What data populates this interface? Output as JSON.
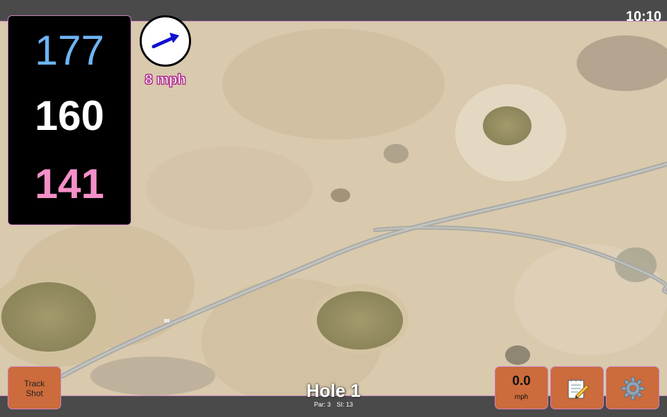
{
  "status": {
    "time": "10:10"
  },
  "distances": {
    "back": "177",
    "middle": "160",
    "front": "141"
  },
  "wind": {
    "speed": "8 mph",
    "direction": "east-north-east",
    "arrow_color": "#1010d0"
  },
  "buttons": {
    "track_shot": {
      "line1": "Track",
      "line2": "Shot"
    },
    "speed": {
      "value": "0.0",
      "unit": "mph"
    },
    "notes": {
      "icon": "notepad-pencil-icon"
    },
    "settings": {
      "icon": "gear-icon"
    }
  },
  "hole": {
    "title": "Hole 1",
    "par_label": "Par: 3",
    "si_label": "SI: 13"
  },
  "colors": {
    "back_distance": "#6eb4f5",
    "middle_distance": "#ffffff",
    "front_distance": "#f58fc8",
    "button_bg": "#cc6b3b",
    "accent_border": "#c884c0"
  }
}
